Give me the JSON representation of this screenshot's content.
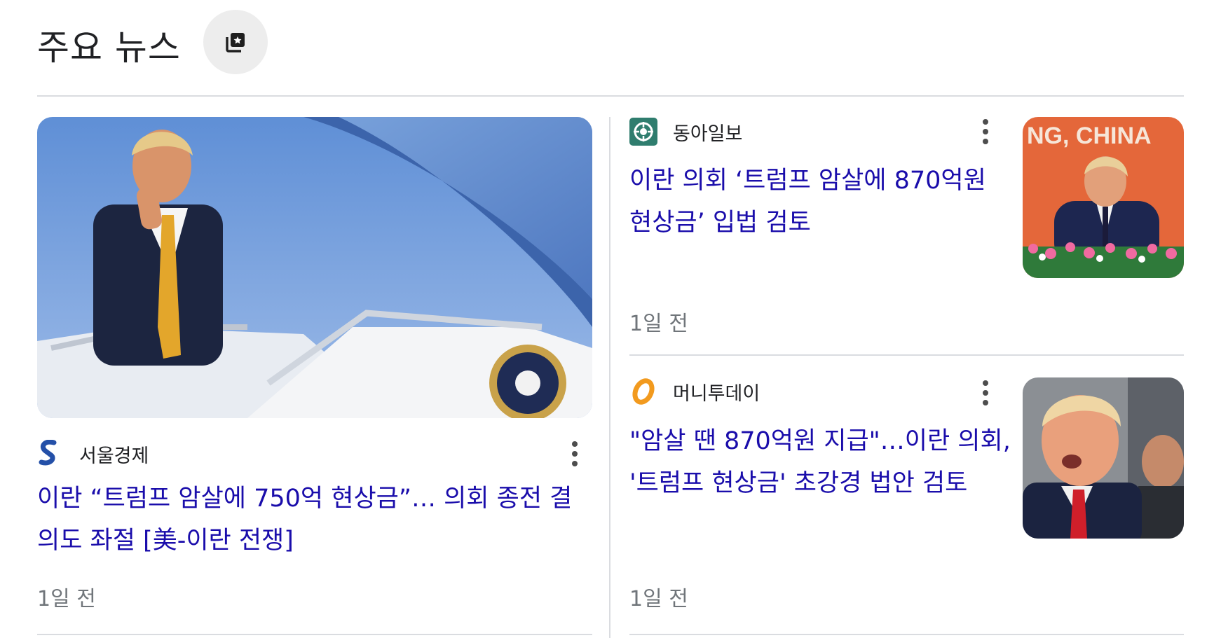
{
  "header": {
    "title": "주요 뉴스",
    "button_icon": "star-bookmark-icon"
  },
  "main_story": {
    "source": "서울경제",
    "source_icon": "seoul-economy-logo-icon",
    "headline": "이란 “트럼프 암살에 750억 현상금”… 의회 종전 결의도 좌절 [美-이란 전쟁]",
    "time": "1일 전"
  },
  "side_stories": [
    {
      "source": "동아일보",
      "source_icon": "donga-logo-icon",
      "headline": "이란 의회 ‘트럼프 암살에 870억원 현상금’ 입법 검토",
      "time": "1일 전",
      "thumb_text": "NG, CHINA"
    },
    {
      "source": "머니투데이",
      "source_icon": "moneytoday-logo-icon",
      "headline": "\"암살 땐 870억원 지급\"…이란 의회, '트럼프 현상금' 초강경 법안 검토",
      "time": "1일 전"
    }
  ],
  "colors": {
    "link": "#1a0dab",
    "meta": "#70757a",
    "divider": "#dadce0"
  }
}
